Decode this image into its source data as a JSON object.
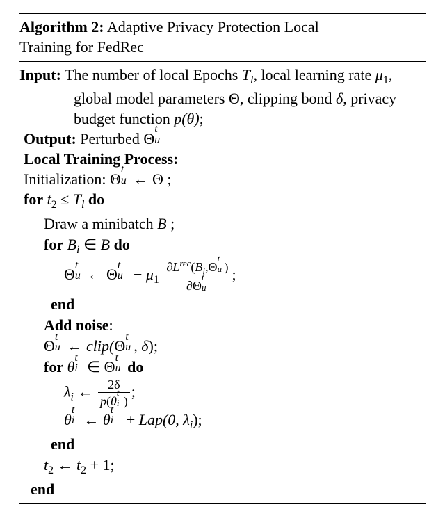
{
  "algo": {
    "label": "Algorithm 2:",
    "title_a": "Adaptive Privacy Protection Local",
    "title_b": "Training for FedRec"
  },
  "io": {
    "input_label": "Input:",
    "input_line1_a": "The number of local Epochs ",
    "input_line1_b": ", local learning",
    "input_line2_a": "rate ",
    "input_line2_b": ", global model parameters Θ, clipping",
    "input_line3_a": "bond ",
    "input_line3_b": ", privacy budget function ",
    "output_label": "Output:",
    "output_text": " Perturbed "
  },
  "sec": {
    "local_training": "Local Training Process:",
    "add_noise": "Add noise"
  },
  "kw": {
    "for": "for",
    "do": "do",
    "end": "end"
  },
  "sym": {
    "Tl": "T",
    "Tl_sub": "l",
    "mu1": "μ",
    "mu1_sub": "1",
    "delta": "δ",
    "p_open": "p(θ)",
    "Theta": "Θ",
    "Theta_u": "u",
    "Theta_t": "t",
    "arrow": "←",
    "Bcal": "B",
    "Bi_sub": "i",
    "Lrec": "L",
    "Lrec_sup": "rec",
    "partial": "∂",
    "theta": "θ",
    "lambda": "λ",
    "two_delta": "2δ",
    "Lap": "Lap(0, λ",
    "clip": "clip("
  },
  "lines": {
    "init_a": "Initialization: ",
    "init_b": " ← Θ ;",
    "outer_for_a": " ≤ ",
    "t2": "t",
    "t2_sub": "2",
    "draw_a": "Draw a minibatch ",
    "draw_b": " ;",
    "inner_for_a": " ∈ ",
    "grad_line_tail": ";",
    "clip_tail": ");",
    "noise_for_a": " ∈ ",
    "lambda_tail": ";",
    "theta_update_tail": ");",
    "inc": " + 1;"
  }
}
